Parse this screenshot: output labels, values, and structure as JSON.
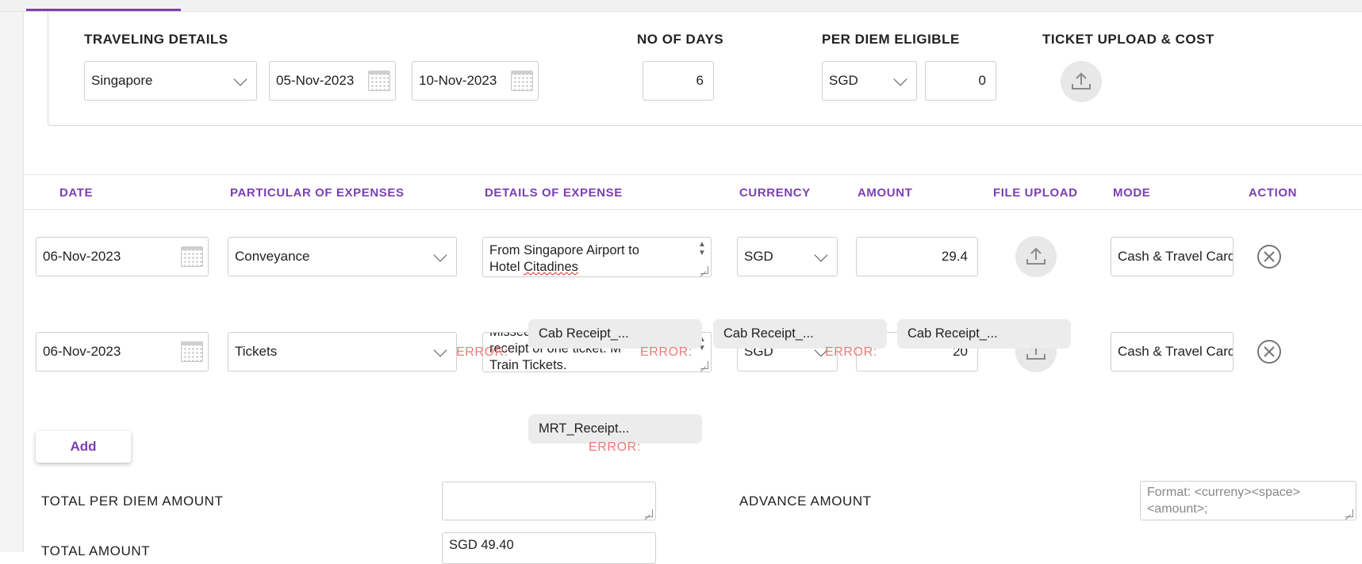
{
  "travel": {
    "headers": {
      "traveling_details": "TRAVELING DETAILS",
      "no_of_days": "NO OF DAYS",
      "per_diem_eligible": "PER DIEM ELIGIBLE",
      "ticket_upload_cost": "TICKET UPLOAD & COST"
    },
    "destination": "Singapore",
    "from_date": "05-Nov-2023",
    "to_date": "10-Nov-2023",
    "no_of_days": "6",
    "per_diem_currency": "SGD",
    "per_diem_amount": "0"
  },
  "columns": {
    "date": "DATE",
    "particular": "PARTICULAR OF EXPENSES",
    "details": "DETAILS OF EXPENSE",
    "currency": "CURRENCY",
    "amount": "AMOUNT",
    "file_upload": "FILE UPLOAD",
    "mode": "MODE",
    "action": "ACTION"
  },
  "rows": [
    {
      "date": "06-Nov-2023",
      "particular": "Conveyance",
      "details_line1": "From Singapore Airport to",
      "details_line2_a": "Hotel ",
      "details_line2_b": "Citadines",
      "currency": "SGD",
      "amount": "29.4",
      "mode": "Cash & Travel Card"
    },
    {
      "date": "06-Nov-2023",
      "particular": "Tickets",
      "details_line1": "Missed",
      "details_line2": "receipt of one ticket. M",
      "details_line3": "Train Tickets.",
      "currency": "SGD",
      "amount": "20",
      "mode": "Cash & Travel Card"
    }
  ],
  "attachments": [
    {
      "name": "Cab Receipt_...",
      "error": "ERROR:"
    },
    {
      "name": "Cab Receipt_...",
      "error": "ERROR:"
    },
    {
      "name": "Cab Receipt_...",
      "error": "ERROR:"
    },
    {
      "name": "MRT_Receipt...",
      "error": "ERROR:"
    }
  ],
  "add_label": "Add",
  "totals": {
    "per_diem_label": "TOTAL PER DIEM AMOUNT",
    "per_diem_value": "",
    "advance_label": "ADVANCE AMOUNT",
    "advance_placeholder": "Format: <curreny><space> <amount>;",
    "total_label": "TOTAL AMOUNT",
    "total_value": "SGD 49.40"
  },
  "colors": {
    "accent": "#7b3fb3",
    "error": "#f07878"
  },
  "icons": [
    "chevron-down-icon",
    "calendar-icon",
    "upload-icon",
    "close-circle-icon"
  ]
}
